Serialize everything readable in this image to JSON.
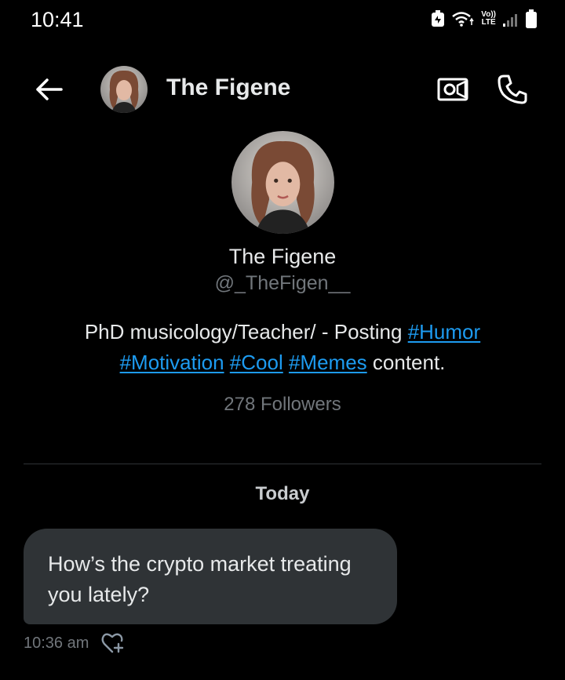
{
  "status_bar": {
    "time": "10:41",
    "volte_line1": "Vo))",
    "volte_line2": "LTE"
  },
  "header": {
    "name": "The Figene",
    "icons": [
      "back-arrow-icon",
      "video-call-icon",
      "phone-icon"
    ]
  },
  "profile": {
    "name": "The Figene",
    "handle": "@_TheFigen__",
    "bio_prefix": "PhD musicology/Teacher/ - Posting ",
    "hashtags": [
      "#Humor",
      "#Motivation",
      "#Cool",
      "#Memes"
    ],
    "bio_suffix": " content.",
    "followers": "278 Followers"
  },
  "conversation": {
    "day_label": "Today",
    "messages": [
      {
        "text": "How’s the crypto market treating you lately?",
        "time": "10:36 am"
      }
    ]
  },
  "colors": {
    "background": "#000000",
    "link": "#1d9bf0",
    "bubble": "#2f3336",
    "secondary_text": "#71767b"
  }
}
